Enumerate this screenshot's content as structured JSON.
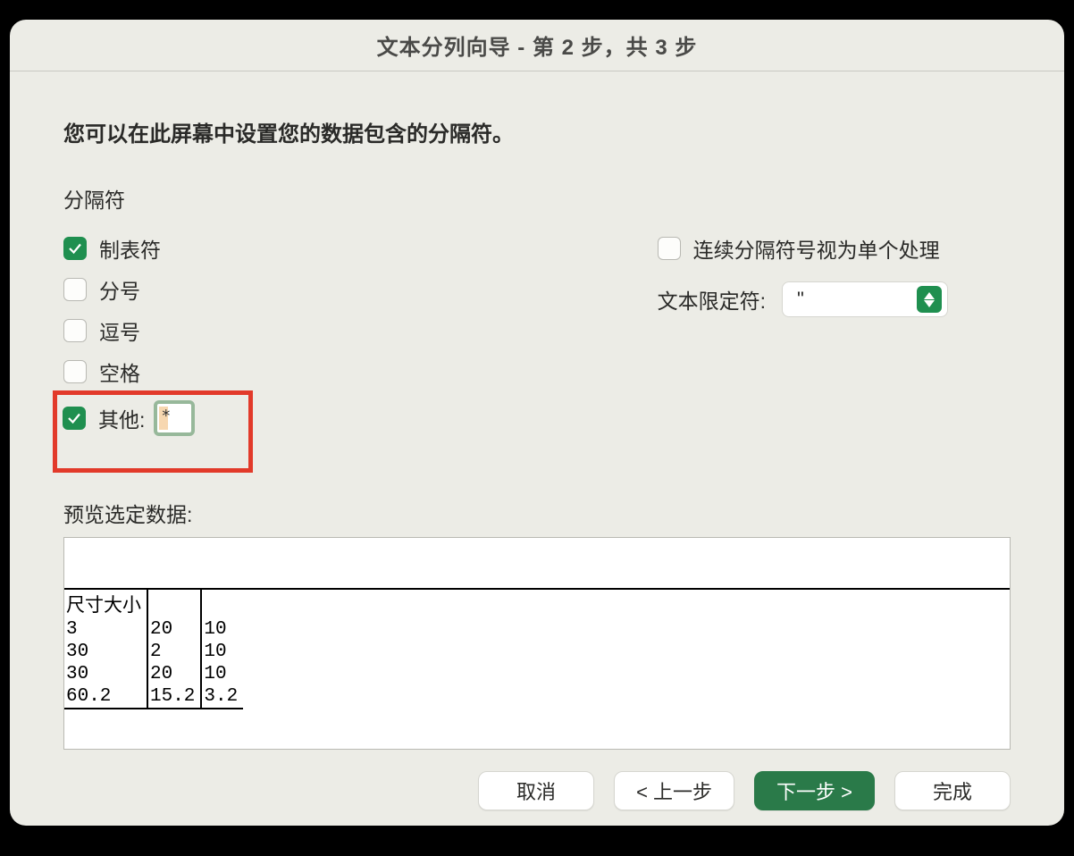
{
  "title": "文本分列向导 - 第 2 步，共 3 步",
  "instruction": "您可以在此屏幕中设置您的数据包含的分隔符。",
  "delimiters": {
    "section_label": "分隔符",
    "tab": {
      "label": "制表符",
      "checked": true
    },
    "semicolon": {
      "label": "分号",
      "checked": false
    },
    "comma": {
      "label": "逗号",
      "checked": false
    },
    "space": {
      "label": "空格",
      "checked": false
    },
    "other": {
      "label": "其他:",
      "checked": true,
      "value": "*"
    }
  },
  "consecutive": {
    "label": "连续分隔符号视为单个处理",
    "checked": false
  },
  "text_qualifier": {
    "label": "文本限定符:",
    "value": "\""
  },
  "preview": {
    "label": "预览选定数据:",
    "col_widths": [
      "88px",
      "50px",
      "auto"
    ],
    "rows": [
      [
        "尺寸大小",
        "",
        ""
      ],
      [
        "3",
        "20",
        "10"
      ],
      [
        "30",
        "2",
        "10"
      ],
      [
        "30",
        "20",
        "10"
      ],
      [
        "60.2",
        "15.2",
        "3.2"
      ]
    ]
  },
  "buttons": {
    "cancel": "取消",
    "back": "< 上一步",
    "next": "下一步 >",
    "finish": "完成"
  }
}
